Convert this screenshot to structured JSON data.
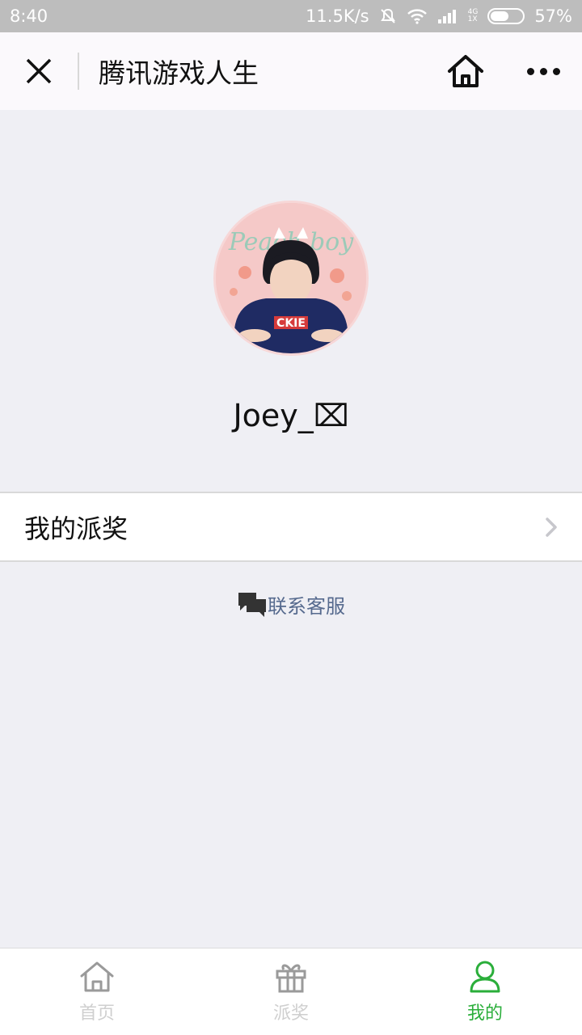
{
  "status_bar": {
    "time": "8:40",
    "network_speed": "11.5K/s",
    "network_type_top": "4G",
    "network_type_bottom": "1X",
    "battery": "57%",
    "battery_level": 0.57
  },
  "nav": {
    "title": "腾讯游戏人生",
    "close_icon": "close-icon",
    "home_icon": "home-icon",
    "more_icon": "more-icon"
  },
  "profile": {
    "avatar_text": "Peach boy",
    "shirt_text": "CKIE",
    "username": "Joey_",
    "username_glyph": "⌧"
  },
  "menu": {
    "my_awards_label": "我的派奖"
  },
  "contact": {
    "label": "联系客服"
  },
  "tabs": [
    {
      "label": "首页",
      "icon": "home-icon",
      "active": false
    },
    {
      "label": "派奖",
      "icon": "gift-icon",
      "active": false
    },
    {
      "label": "我的",
      "icon": "user-icon",
      "active": true
    }
  ],
  "colors": {
    "accent": "#2aae3a",
    "link": "#566a8e",
    "background": "#efeff4"
  }
}
